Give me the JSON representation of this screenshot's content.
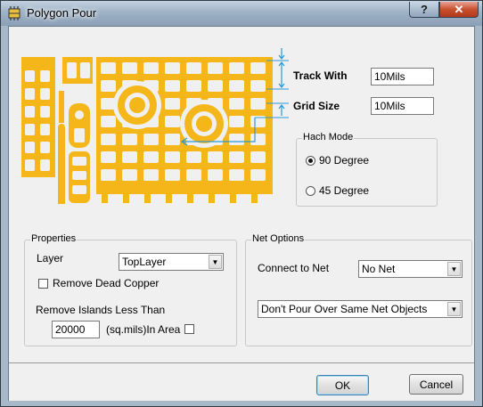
{
  "window": {
    "title": "Polygon Pour",
    "help_label": "?",
    "close_label": "✕"
  },
  "icons": {
    "app": "pcb-chip-icon",
    "diagram": "polygon-pour-preview-icon"
  },
  "colors": {
    "copper": "#f5b61a",
    "dimension": "#2a9ad8"
  },
  "params": {
    "track_with_label": "Track With",
    "track_with_value": "10Mils",
    "grid_size_label": "Grid Size",
    "grid_size_value": "10Mils"
  },
  "hatch": {
    "title": "Hach Mode",
    "options": [
      {
        "label": "90 Degree",
        "checked": true
      },
      {
        "label": "45 Degree",
        "checked": false
      }
    ]
  },
  "properties": {
    "title": "Properties",
    "layer_label": "Layer",
    "layer_value": "TopLayer",
    "remove_dead_copper_label": "Remove Dead Copper",
    "remove_dead_copper_checked": false,
    "islands_label": "Remove Islands Less Than",
    "islands_value": "20000",
    "islands_unit": "(sq.mils)In Area",
    "islands_checked": false
  },
  "net": {
    "title": "Net Options",
    "connect_label": "Connect to Net",
    "connect_value": "No Net",
    "pour_value": "Don't Pour Over Same Net Objects"
  },
  "buttons": {
    "ok": "OK",
    "cancel": "Cancel"
  }
}
